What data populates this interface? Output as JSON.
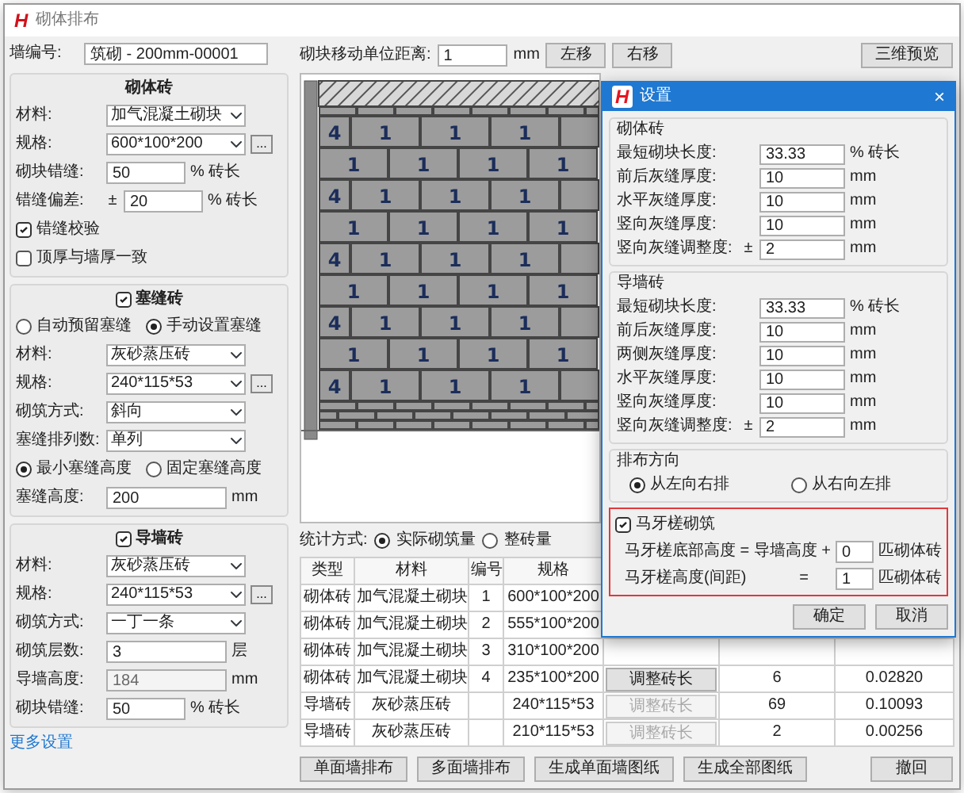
{
  "window": {
    "logo": "H",
    "title": "砌体排布"
  },
  "wall_id": {
    "label": "墙编号:",
    "value": "筑砌 - 200mm-00001"
  },
  "masonry_group": {
    "title": "砌体砖",
    "fields": [
      {
        "kind": "select",
        "label": "材料:",
        "value": "加气混凝土砌块"
      },
      {
        "kind": "select",
        "label": "规格:",
        "value": "600*100*200",
        "more": "..."
      },
      {
        "kind": "input",
        "label": "砌块错缝:",
        "value": "50",
        "unit": "% 砖长"
      },
      {
        "kind": "input",
        "label": "错缝偏差:",
        "prefix": "±",
        "value": "20",
        "unit": "% 砖长"
      },
      {
        "kind": "check",
        "label": "错缝校验",
        "checked": true
      },
      {
        "kind": "check",
        "label": "顶厚与墙厚一致",
        "checked": false
      }
    ]
  },
  "filler_group": {
    "title": "塞缝砖",
    "checked": true,
    "fields": [
      {
        "kind": "radios",
        "options": [
          {
            "label": "自动预留塞缝",
            "selected": false
          },
          {
            "label": "手动设置塞缝",
            "selected": true
          }
        ]
      },
      {
        "kind": "select",
        "label": "材料:",
        "value": "灰砂蒸压砖"
      },
      {
        "kind": "select",
        "label": "规格:",
        "value": "240*115*53",
        "more": "..."
      },
      {
        "kind": "select",
        "label": "砌筑方式:",
        "value": "斜向"
      },
      {
        "kind": "select",
        "label": "塞缝排列数:",
        "value": "单列"
      },
      {
        "kind": "radios",
        "options": [
          {
            "label": "最小塞缝高度",
            "selected": true
          },
          {
            "label": "固定塞缝高度",
            "selected": false
          }
        ]
      },
      {
        "kind": "input",
        "label": "塞缝高度:",
        "value": "200",
        "unit": "mm"
      }
    ]
  },
  "guide_group": {
    "title": "导墙砖",
    "checked": true,
    "fields": [
      {
        "kind": "select",
        "label": "材料:",
        "value": "灰砂蒸压砖",
        "disabled": false
      },
      {
        "kind": "select",
        "label": "规格:",
        "value": "240*115*53",
        "more": "...",
        "disabled": false
      },
      {
        "kind": "select",
        "label": "砌筑方式:",
        "value": "一丁一条",
        "disabled": false
      },
      {
        "kind": "input",
        "label": "砌筑层数:",
        "value": "3",
        "unit": "层",
        "disabled": false
      },
      {
        "kind": "input",
        "label": "导墙高度:",
        "value": "184",
        "unit": "mm",
        "disabled": true
      },
      {
        "kind": "input",
        "label": "砌块错缝:",
        "value": "50",
        "unit": "% 砖长",
        "disabled": false
      }
    ]
  },
  "more_settings": "更多设置",
  "toolbar": {
    "label": "砌块移动单位距离:",
    "value": "1",
    "unit": "mm",
    "buttons": [
      "左移",
      "右移"
    ],
    "preview": "三维预览"
  },
  "wall": {
    "courses": [
      {
        "kind": "beam"
      },
      {
        "kind": "filler"
      },
      {
        "kind": "short-start",
        "labels": [
          "4",
          "1",
          "1",
          "1"
        ]
      },
      {
        "kind": "full-start",
        "labels": [
          "1",
          "1",
          "1",
          "1"
        ]
      },
      {
        "kind": "short-start",
        "labels": [
          "4",
          "1",
          "1",
          "1"
        ]
      },
      {
        "kind": "full-start",
        "labels": [
          "1",
          "1",
          "1",
          "1"
        ]
      },
      {
        "kind": "short-start",
        "labels": [
          "4",
          "1",
          "1",
          "1"
        ]
      },
      {
        "kind": "full-start",
        "labels": [
          "1",
          "1",
          "1",
          "1"
        ]
      },
      {
        "kind": "short-start",
        "labels": [
          "4",
          "1",
          "1",
          "1"
        ]
      },
      {
        "kind": "full-start",
        "labels": [
          "1",
          "1",
          "1",
          "1"
        ]
      },
      {
        "kind": "short-start",
        "labels": [
          "4",
          "1",
          "1",
          "1"
        ]
      },
      {
        "kind": "guide"
      },
      {
        "kind": "guide"
      },
      {
        "kind": "guide"
      }
    ]
  },
  "stats": {
    "label": "统计方式:",
    "options": [
      {
        "label": "实际砌筑量",
        "selected": true
      },
      {
        "label": "整砖量",
        "selected": false
      }
    ]
  },
  "table": {
    "columns": [
      "类型",
      "材料",
      "编号",
      "规格"
    ],
    "rows": [
      {
        "type": "砌体砖",
        "material": "加气混凝土砌块",
        "number": "1",
        "spec": "600*100*200"
      },
      {
        "type": "砌体砖",
        "material": "加气混凝土砌块",
        "number": "2",
        "spec": "555*100*200"
      },
      {
        "type": "砌体砖",
        "material": "加气混凝土砌块",
        "number": "3",
        "spec": "310*100*200"
      },
      {
        "type": "砌体砖",
        "material": "加气混凝土砌块",
        "number": "4",
        "spec": "235*100*200",
        "adjust": {
          "label": "调整砖长",
          "disabled": false
        },
        "count": "6",
        "volume": "0.02820"
      },
      {
        "type": "导墙砖",
        "material": "灰砂蒸压砖",
        "spec": "240*115*53",
        "adjust": {
          "label": "调整砖长",
          "disabled": true
        },
        "count": "69",
        "volume": "0.10093"
      },
      {
        "type": "导墙砖",
        "material": "灰砂蒸压砖",
        "spec": "210*115*53",
        "adjust": {
          "label": "调整砖长",
          "disabled": true
        },
        "count": "2",
        "volume": "0.00256"
      }
    ]
  },
  "buttons": [
    "单面墙排布",
    "多面墙排布",
    "生成单面墙图纸",
    "生成全部图纸"
  ],
  "undo": "撤回",
  "dialog": {
    "logo": "H",
    "title": "设置",
    "close": "×",
    "groups": [
      {
        "title": "砌体砖",
        "fields": [
          {
            "label": "最短砌块长度:",
            "value": "33.33",
            "unit": "% 砖长"
          },
          {
            "label": "前后灰缝厚度:",
            "value": "10",
            "unit": "mm"
          },
          {
            "label": "水平灰缝厚度:",
            "value": "10",
            "unit": "mm"
          },
          {
            "label": "竖向灰缝厚度:",
            "value": "10",
            "unit": "mm"
          },
          {
            "label": "竖向灰缝调整度:",
            "prefix": "±",
            "value": "2",
            "unit": "mm"
          }
        ]
      },
      {
        "title": "导墙砖",
        "fields": [
          {
            "label": "最短砌块长度:",
            "value": "33.33",
            "unit": "% 砖长"
          },
          {
            "label": "前后灰缝厚度:",
            "value": "10",
            "unit": "mm"
          },
          {
            "label": "两侧灰缝厚度:",
            "value": "10",
            "unit": "mm"
          },
          {
            "label": "水平灰缝厚度:",
            "value": "10",
            "unit": "mm"
          },
          {
            "label": "竖向灰缝厚度:",
            "value": "10",
            "unit": "mm"
          },
          {
            "label": "竖向灰缝调整度:",
            "prefix": "±",
            "value": "2",
            "unit": "mm"
          }
        ]
      }
    ],
    "direction": {
      "title": "排布方向",
      "options": [
        {
          "label": "从左向右排",
          "selected": true
        },
        {
          "label": "从右向左排",
          "selected": false
        }
      ]
    },
    "toothing": {
      "label": "马牙槎砌筑",
      "checked": true,
      "rows": [
        {
          "label": "马牙槎底部高度 = 导墙高度 +",
          "value": "0",
          "unit": "匹砌体砖"
        },
        {
          "label": "马牙槎高度(间距)",
          "eq": "=",
          "value": "1",
          "unit": "匹砌体砖"
        }
      ]
    },
    "buttons": [
      "确定",
      "取消"
    ]
  }
}
